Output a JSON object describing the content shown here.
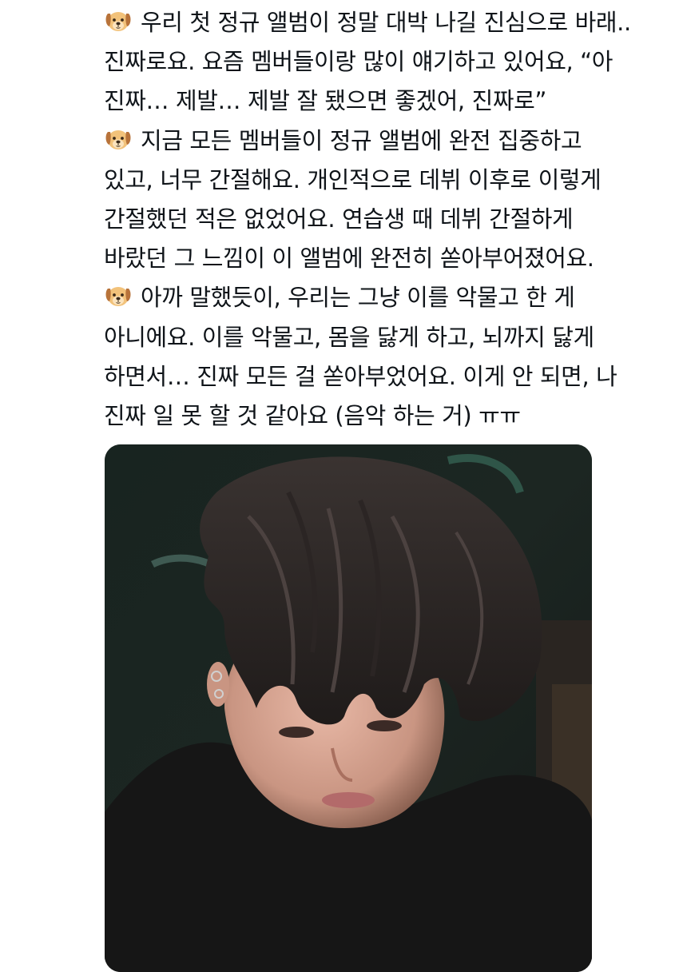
{
  "tweet": {
    "lines": [
      {
        "emoji": "dog-face",
        "text": "우리 첫 정규 앨범이 정말 대박 나길 진심으로 바래.."
      },
      {
        "text": "진짜로요. 요즘 멤버들이랑 많이 얘기하고 있어요, “아"
      },
      {
        "text": "진짜… 제발… 제발 잘 됐으면 좋겠어, 진짜로”"
      },
      {
        "emoji": "dog-face",
        "text": "지금 모든 멤버들이 정규 앨범에 완전 집중하고"
      },
      {
        "text": "있고, 너무 간절해요. 개인적으로 데뷔 이후로 이렇게"
      },
      {
        "text": "간절했던 적은 없었어요. 연습생 때 데뷔 간절하게"
      },
      {
        "text": "바랐던 그 느낌이 이 앨범에 완전히 쏟아부어졌어요."
      },
      {
        "emoji": "dog-face",
        "text": "아까 말했듯이, 우리는 그냥 이를 악물고 한 게"
      },
      {
        "text": "아니에요. 이를 악물고, 몸을 닳게 하고, 뇌까지 닳게"
      },
      {
        "text": "하면서… 진짜 모든 걸 쏟아부었어요. 이게 안 되면, 나"
      },
      {
        "text": "진짜 일 못 할 것 같아요 (음악 하는 거) ㅠㅠ"
      }
    ]
  },
  "media": {
    "kind": "photo",
    "description_icon": "person-photo"
  },
  "colors": {
    "text": "#0f1419",
    "background": "#ffffff",
    "emoji_fur": "#f2c27a",
    "emoji_ear": "#b8733a"
  }
}
